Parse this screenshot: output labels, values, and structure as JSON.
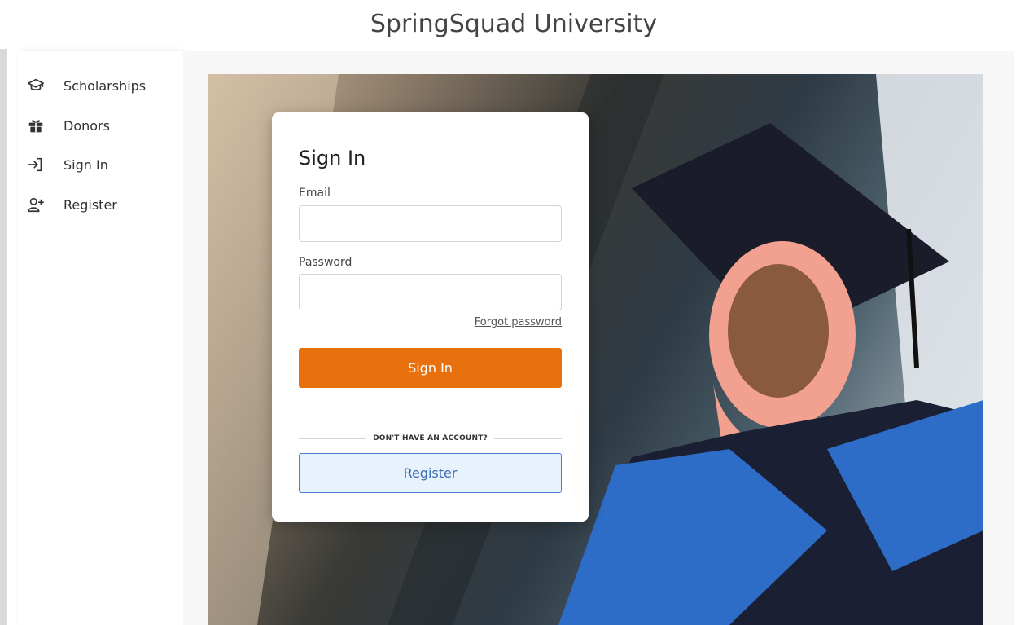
{
  "app": {
    "title": "SpringSquad University"
  },
  "sidebar": {
    "items": [
      {
        "label": "Scholarships",
        "icon": "graduation-cap-icon"
      },
      {
        "label": "Donors",
        "icon": "gift-icon"
      },
      {
        "label": "Sign In",
        "icon": "sign-in-icon"
      },
      {
        "label": "Register",
        "icon": "user-plus-icon"
      }
    ]
  },
  "hero": {
    "image": "graduate-in-cap-and-gown-photo"
  },
  "signin": {
    "title": "Sign In",
    "email_label": "Email",
    "email_value": "",
    "password_label": "Password",
    "password_value": "",
    "forgot_label": "Forgot password",
    "submit_label": "Sign In",
    "divider_text": "DON'T HAVE AN ACCOUNT?",
    "register_label": "Register"
  },
  "colors": {
    "primary": "#e8700d",
    "secondary_bg": "#e8f2fd",
    "secondary_text": "#3a6fb3",
    "secondary_border": "#4a7fc7"
  }
}
